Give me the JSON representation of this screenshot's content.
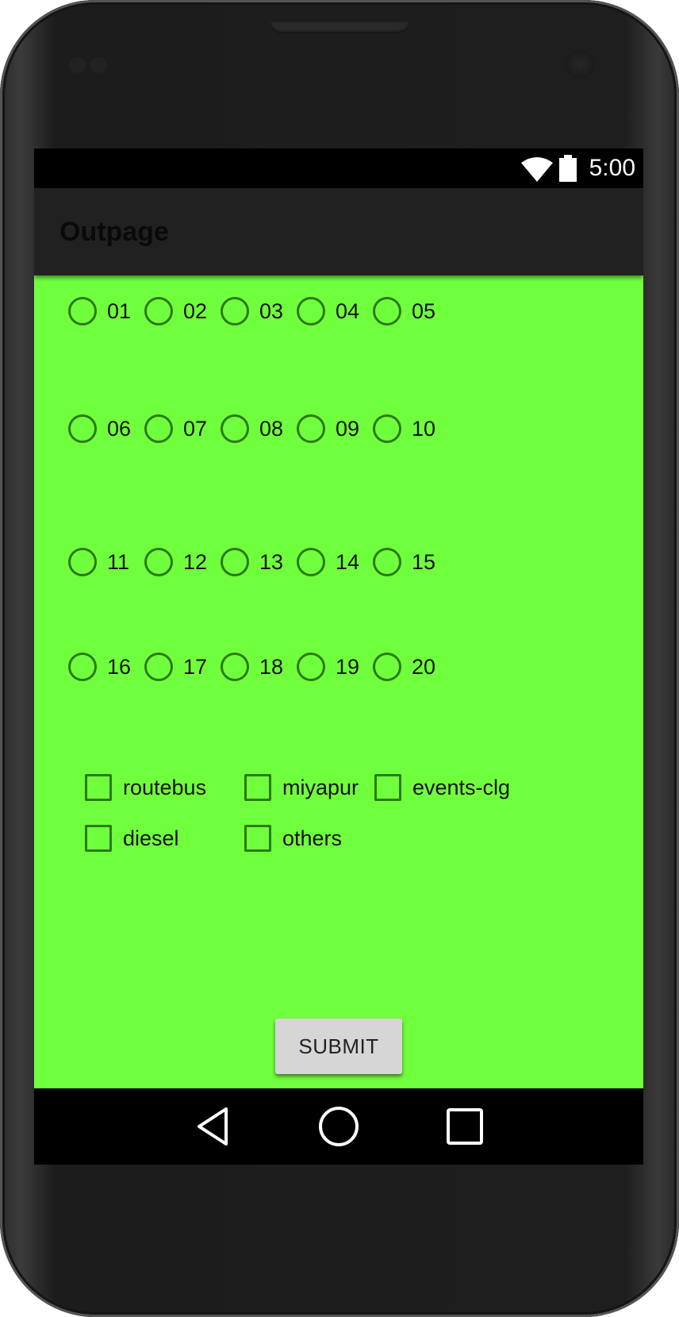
{
  "status_bar": {
    "time": "5:00",
    "icons": [
      "wifi-icon",
      "battery-icon"
    ]
  },
  "app_bar": {
    "title": "Outpage"
  },
  "radio_rows": [
    [
      "01",
      "02",
      "03",
      "04",
      "05"
    ],
    [
      "06",
      "07",
      "08",
      "09",
      "10"
    ],
    [
      "11",
      "12",
      "13",
      "14",
      "15"
    ],
    [
      "16",
      "17",
      "18",
      "19",
      "20"
    ]
  ],
  "checkboxes": [
    "routebus",
    "miyapur",
    "events-clg",
    "diesel",
    "others"
  ],
  "submit_label": "SUBMIT",
  "nav_bar": {
    "icons": [
      "back-icon",
      "home-icon",
      "recents-icon"
    ]
  },
  "colors": {
    "content_background": "#70ff3d",
    "control_accent": "#2c7a12",
    "app_bar": "#212121",
    "button": "#d6d6d6"
  }
}
